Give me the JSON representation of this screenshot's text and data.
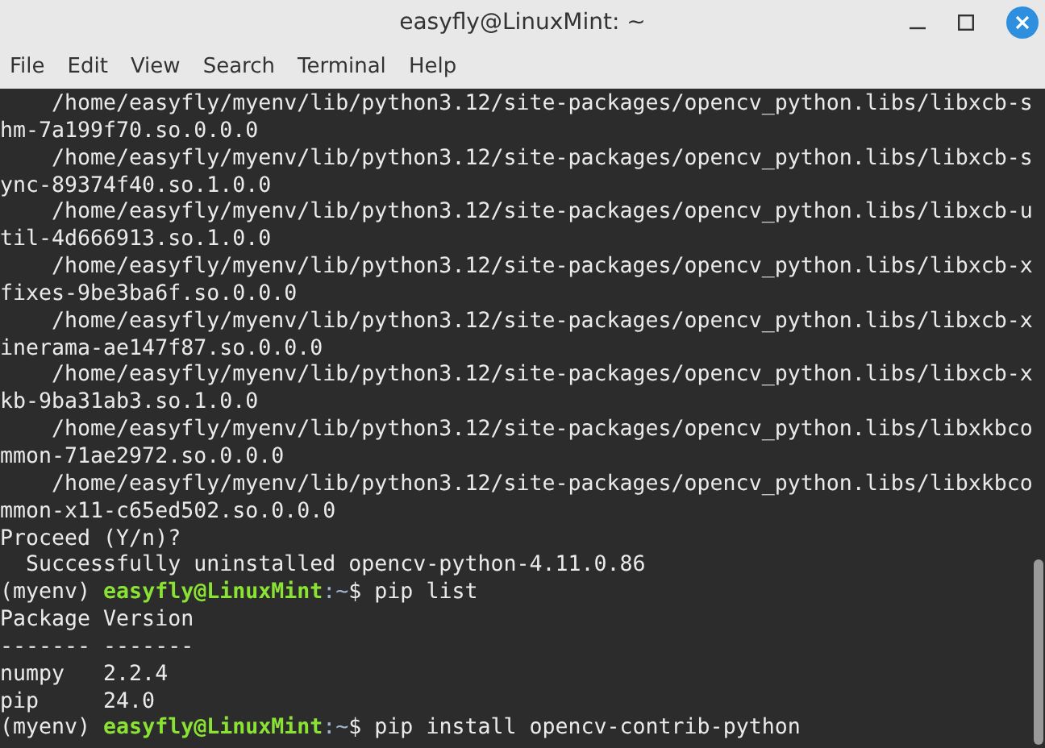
{
  "window": {
    "title": "easyfly@LinuxMint: ~"
  },
  "menu": [
    "File",
    "Edit",
    "View",
    "Search",
    "Terminal",
    "Help"
  ],
  "terminal": {
    "lines": [
      {
        "kind": "output",
        "text": "    /home/easyfly/myenv/lib/python3.12/site-packages/opencv_python.libs/libxcb-s"
      },
      {
        "kind": "output",
        "text": "hm-7a199f70.so.0.0.0"
      },
      {
        "kind": "output",
        "text": "    /home/easyfly/myenv/lib/python3.12/site-packages/opencv_python.libs/libxcb-s"
      },
      {
        "kind": "output",
        "text": "ync-89374f40.so.1.0.0"
      },
      {
        "kind": "output",
        "text": "    /home/easyfly/myenv/lib/python3.12/site-packages/opencv_python.libs/libxcb-u"
      },
      {
        "kind": "output",
        "text": "til-4d666913.so.1.0.0"
      },
      {
        "kind": "output",
        "text": "    /home/easyfly/myenv/lib/python3.12/site-packages/opencv_python.libs/libxcb-x"
      },
      {
        "kind": "output",
        "text": "fixes-9be3ba6f.so.0.0.0"
      },
      {
        "kind": "output",
        "text": "    /home/easyfly/myenv/lib/python3.12/site-packages/opencv_python.libs/libxcb-x"
      },
      {
        "kind": "output",
        "text": "inerama-ae147f87.so.0.0.0"
      },
      {
        "kind": "output",
        "text": "    /home/easyfly/myenv/lib/python3.12/site-packages/opencv_python.libs/libxcb-x"
      },
      {
        "kind": "output",
        "text": "kb-9ba31ab3.so.1.0.0"
      },
      {
        "kind": "output",
        "text": "    /home/easyfly/myenv/lib/python3.12/site-packages/opencv_python.libs/libxkbco"
      },
      {
        "kind": "output",
        "text": "mmon-71ae2972.so.0.0.0"
      },
      {
        "kind": "output",
        "text": "    /home/easyfly/myenv/lib/python3.12/site-packages/opencv_python.libs/libxkbco"
      },
      {
        "kind": "output",
        "text": "mmon-x11-c65ed502.so.0.0.0"
      },
      {
        "kind": "output",
        "text": "Proceed (Y/n)?"
      },
      {
        "kind": "output",
        "text": "  Successfully uninstalled opencv-python-4.11.0.86"
      },
      {
        "kind": "prompt",
        "env": "(myenv) ",
        "user": "easyfly@LinuxMint",
        "path": ":~",
        "command": "$ pip list"
      },
      {
        "kind": "output",
        "text": "Package Version"
      },
      {
        "kind": "output",
        "text": "------- -------"
      },
      {
        "kind": "output",
        "text": "numpy   2.2.4"
      },
      {
        "kind": "output",
        "text": "pip     24.0"
      },
      {
        "kind": "prompt",
        "env": "(myenv) ",
        "user": "easyfly@LinuxMint",
        "path": ":~",
        "command": "$ pip install opencv-contrib-python"
      }
    ]
  }
}
